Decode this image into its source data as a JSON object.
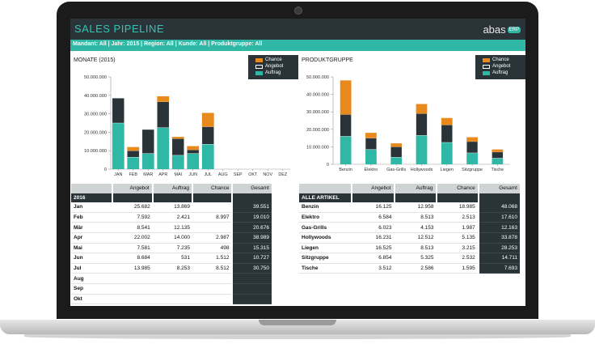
{
  "header": {
    "title": "SALES PIPELINE",
    "logo_text": "abas",
    "logo_badge": "ERP"
  },
  "filter_bar": {
    "text": "Mandant: All | Jahr: 2015 | Region: All | Kunde: All | Produktgruppe: All"
  },
  "colors": {
    "chance": "#e8891c",
    "angebot": "#2a3438",
    "auftrag": "#2fb8a6"
  },
  "legend": [
    "Chance",
    "Angebot",
    "Auftrag"
  ],
  "chart_data": [
    {
      "type": "bar",
      "stacked": true,
      "title": "MONATE (2015)",
      "categories": [
        "JAN",
        "FEB",
        "MAR",
        "APR",
        "MAI",
        "JUN",
        "JUL",
        "AUG",
        "SEP",
        "OKT",
        "NOV",
        "DEZ"
      ],
      "series": [
        {
          "name": "Auftrag",
          "values": [
            25000000,
            6500000,
            8500000,
            22500000,
            7500000,
            8500000,
            13500000,
            0,
            0,
            0,
            0,
            0
          ]
        },
        {
          "name": "Angebot",
          "values": [
            13500000,
            3500000,
            13000000,
            14000000,
            9000000,
            2000000,
            9500000,
            0,
            0,
            0,
            0,
            0
          ]
        },
        {
          "name": "Chance",
          "values": [
            0,
            2000000,
            0,
            3000000,
            1000000,
            2000000,
            7500000,
            0,
            0,
            0,
            0,
            0
          ]
        }
      ],
      "yticks": [
        "0",
        "10.000.000",
        "20.000.000",
        "30.000.000",
        "40.000.000",
        "50.000.000"
      ],
      "ylim": [
        0,
        50000000
      ],
      "legend_position": "top-right"
    },
    {
      "type": "bar",
      "stacked": true,
      "title": "PRODUKTGRUPPE",
      "categories": [
        "Benzin",
        "Elektro",
        "Gas-Grills",
        "Hollywoods",
        "Liegen",
        "Sitzgruppe",
        "Tische"
      ],
      "series": [
        {
          "name": "Auftrag",
          "values": [
            16000000,
            8500000,
            4000000,
            16500000,
            12500000,
            6500000,
            3500000
          ]
        },
        {
          "name": "Angebot",
          "values": [
            12500000,
            6500000,
            6000000,
            12500000,
            10000000,
            6500000,
            3500000
          ]
        },
        {
          "name": "Chance",
          "values": [
            19500000,
            3000000,
            2000000,
            5500000,
            4000000,
            2500000,
            1500000
          ]
        }
      ],
      "yticks": [
        "0",
        "10.000.000",
        "20.000.000",
        "30.000.000",
        "40.000.000",
        "50.000.000"
      ],
      "ylim": [
        0,
        50000000
      ],
      "legend_position": "top-right"
    }
  ],
  "months_table": {
    "year": "2016",
    "columns": [
      "Angebot",
      "Auftrag",
      "Chance",
      "Gesamt"
    ],
    "rows": [
      {
        "label": "Jan",
        "angebot": "25.682",
        "auftrag": "13.869",
        "chance": "",
        "gesamt": "39.551"
      },
      {
        "label": "Feb",
        "angebot": "7.592",
        "auftrag": "2.421",
        "chance": "8.997",
        "gesamt": "19.010"
      },
      {
        "label": "Mär",
        "angebot": "8.541",
        "auftrag": "12.135",
        "chance": "",
        "gesamt": "20.676"
      },
      {
        "label": "Apr",
        "angebot": "22.002",
        "auftrag": "14.000",
        "chance": "2.987",
        "gesamt": "38.989"
      },
      {
        "label": "Mai",
        "angebot": "7.581",
        "auftrag": "7.235",
        "chance": "498",
        "gesamt": "15.315"
      },
      {
        "label": "Jun",
        "angebot": "8.684",
        "auftrag": "531",
        "chance": "1.512",
        "gesamt": "10.727"
      },
      {
        "label": "Jul",
        "angebot": "13.985",
        "auftrag": "8.253",
        "chance": "8.512",
        "gesamt": "30.750"
      },
      {
        "label": "Aug",
        "angebot": "",
        "auftrag": "",
        "chance": "",
        "gesamt": ""
      },
      {
        "label": "Sep",
        "angebot": "",
        "auftrag": "",
        "chance": "",
        "gesamt": ""
      },
      {
        "label": "Okt",
        "angebot": "",
        "auftrag": "",
        "chance": "",
        "gesamt": ""
      }
    ]
  },
  "products_table": {
    "header": "ALLE ARTIKEL",
    "columns": [
      "Angebot",
      "Auftrag",
      "Chance",
      "Gesamt"
    ],
    "rows": [
      {
        "label": "Benzin",
        "angebot": "16.125",
        "auftrag": "12.958",
        "chance": "18.985",
        "gesamt": "48.068"
      },
      {
        "label": "Elektro",
        "angebot": "6.584",
        "auftrag": "8.513",
        "chance": "2.513",
        "gesamt": "17.610"
      },
      {
        "label": "Gas-Grills",
        "angebot": "6.023",
        "auftrag": "4.153",
        "chance": "1.987",
        "gesamt": "12.163"
      },
      {
        "label": "Hollywoods",
        "angebot": "16.231",
        "auftrag": "12.512",
        "chance": "5.135",
        "gesamt": "33.878"
      },
      {
        "label": "Liegen",
        "angebot": "16.525",
        "auftrag": "8.513",
        "chance": "3.215",
        "gesamt": "28.253"
      },
      {
        "label": "Sitzgruppe",
        "angebot": "6.854",
        "auftrag": "5.325",
        "chance": "2.532",
        "gesamt": "14.711"
      },
      {
        "label": "Tische",
        "angebot": "3.512",
        "auftrag": "2.586",
        "chance": "1.595",
        "gesamt": "7.693"
      }
    ]
  }
}
